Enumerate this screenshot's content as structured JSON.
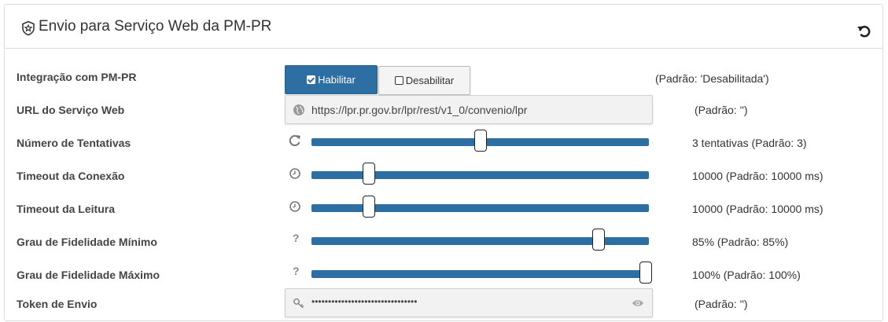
{
  "header": {
    "title": "Envio para Serviço Web da PM-PR",
    "icon": "shield-star-icon",
    "reset_icon": "reset-icon"
  },
  "rows": {
    "integracao": {
      "label": "Integração com PM-PR",
      "enable_label": "Habilitar",
      "disable_label": "Desabilitar",
      "selected": "Habilitar",
      "hint": "(Padrão: 'Desabilitada')"
    },
    "url": {
      "label": "URL do Serviço Web",
      "value": "https://lpr.pr.gov.br/lpr/rest/v1_0/convenio/lpr",
      "icon": "globe-icon",
      "hint": "(Padrão: '')"
    },
    "tentativas": {
      "label": "Número de Tentativas",
      "icon": "refresh-icon",
      "slider_fraction": 0.5,
      "hint": "3 tentativas  (Padrão: 3)"
    },
    "timeout_conexao": {
      "label": "Timeout da Conexão",
      "icon": "clock-icon",
      "slider_fraction": 0.17,
      "hint": "10000  (Padrão: 10000 ms)"
    },
    "timeout_leitura": {
      "label": "Timeout da Leitura",
      "icon": "clock-icon",
      "slider_fraction": 0.17,
      "hint": "10000  (Padrão: 10000 ms)"
    },
    "fidelidade_minimo": {
      "label": "Grau de Fidelidade Mínimo",
      "icon": "question-icon",
      "icon_text": "?",
      "slider_fraction": 0.85,
      "hint": "85%  (Padrão: 85%)"
    },
    "fidelidade_maximo": {
      "label": "Grau de Fidelidade Máximo",
      "icon": "question-icon",
      "icon_text": "?",
      "slider_fraction": 1.0,
      "hint": "100%  (Padrão: 100%)"
    },
    "token": {
      "label": "Token de Envio",
      "value": "••••••••••••••••••••••••••••••••",
      "icon": "key-icon",
      "eye_icon": "eye-icon",
      "hint": "(Padrão: '')"
    }
  },
  "colors": {
    "accent": "#2e6fa3",
    "field_bg": "#f2f2f2"
  }
}
